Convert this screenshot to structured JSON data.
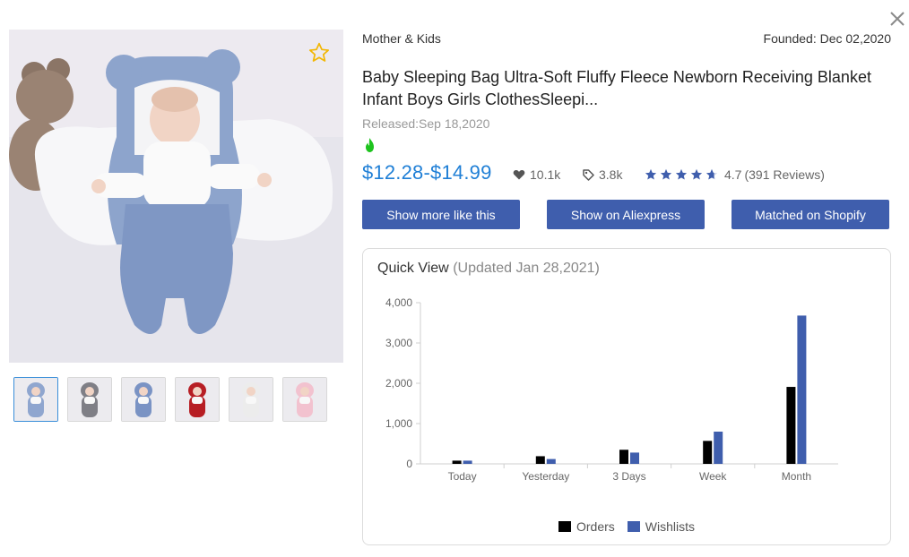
{
  "product": {
    "category": "Mother & Kids",
    "founded": "Founded: Dec 02,2020",
    "title": "Baby Sleeping Bag Ultra-Soft Fluffy Fleece Newborn Receiving Blanket Infant Boys Girls ClothesSleepi...",
    "released": "Released:Sep 18,2020",
    "price": "$12.28-$14.99",
    "likes": "10.1k",
    "tags": "3.8k",
    "rating": "4.7",
    "rating_value": 4.7,
    "reviews": "(391 Reviews)"
  },
  "icons": {
    "close": "close-icon",
    "favorite": "star-outline-icon",
    "hot": "fire-icon",
    "likes": "heart-icon",
    "tags": "tag-icon",
    "rating": "star-icon"
  },
  "colors": {
    "price": "#1f7fd6",
    "button": "#3f5ead",
    "hot": "#1ec31e",
    "star_fav": "#f2b705",
    "orders": "#000000",
    "wishlists": "#3f5ead"
  },
  "gallery": {
    "thumbnails": [
      {
        "color": "#8fa6cf",
        "active": true
      },
      {
        "color": "#7f7f86",
        "active": false
      },
      {
        "color": "#7a93c4",
        "active": false
      },
      {
        "color": "#b71e24",
        "active": false
      },
      {
        "color": "#ececec",
        "active": false
      },
      {
        "color": "#f2c2cf",
        "active": false
      }
    ]
  },
  "buttons": {
    "more": "Show more like this",
    "aliexpress": "Show on Aliexpress",
    "shopify": "Matched on Shopify"
  },
  "quick_view": {
    "title": "Quick View",
    "updated": "(Updated Jan 28,2021)"
  },
  "chart_data": {
    "type": "bar",
    "categories": [
      "Today",
      "Yesterday",
      "3 Days",
      "Week",
      "Month"
    ],
    "series": [
      {
        "name": "Orders",
        "values": [
          80,
          190,
          350,
          570,
          1910
        ],
        "color": "#000000"
      },
      {
        "name": "Wishlists",
        "values": [
          80,
          120,
          280,
          800,
          3680
        ],
        "color": "#3f5ead"
      }
    ],
    "ylim": [
      0,
      4000
    ],
    "yticks": [
      0,
      1000,
      2000,
      3000,
      4000
    ],
    "ytick_labels": [
      "0",
      "1,000",
      "2,000",
      "3,000",
      "4,000"
    ],
    "legend": "bottom",
    "grid": false
  }
}
